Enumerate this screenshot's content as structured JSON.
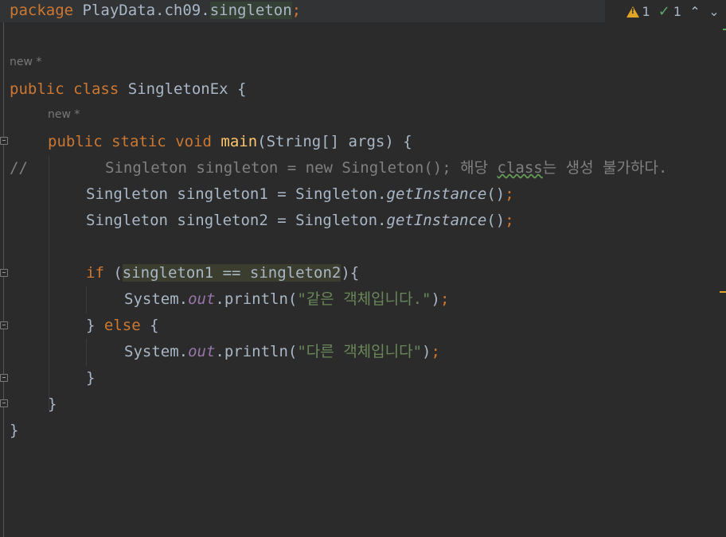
{
  "editor": {
    "line1": {
      "kw": "package",
      "pkg_prefix": "PlayData.ch09.",
      "pkg_hl": "singleton",
      "semi": ";"
    },
    "hint_class": "new *",
    "line3": {
      "kw1": "public",
      "kw2": "class",
      "name": "SingletonEx",
      "brace": "{"
    },
    "hint_method": "new *",
    "line5": {
      "kw1": "public",
      "kw2": "static",
      "kw3": "void",
      "fn": "main",
      "params": "(String[] args) {"
    },
    "line6": {
      "slashes": "//",
      "code": "Singleton singleton = new Singleton(); 해당 ",
      "squig": "class",
      "rest": "는 생성 불가하다."
    },
    "line7": {
      "a": "Singleton singleton1 = Singleton.",
      "call": "getInstance",
      "b": "()",
      "semi": ";"
    },
    "line8": {
      "a": "Singleton singleton2 = Singleton.",
      "call": "getInstance",
      "b": "()",
      "semi": ";"
    },
    "line10": {
      "kw": "if",
      "open": " (",
      "cond": "singleton1 == singleton2",
      "close": "){"
    },
    "line11": {
      "a": "System.",
      "field": "out",
      "b": ".println(",
      "str": "\"같은 객체입니다.\"",
      "c": ")",
      "semi": ";"
    },
    "line12": {
      "a": "} ",
      "kw": "else",
      "b": " {"
    },
    "line13": {
      "a": "System.",
      "field": "out",
      "b": ".println(",
      "str": "\"다른 객체입니다\"",
      "c": ")",
      "semi": ";"
    },
    "line14": "}",
    "line15": "}",
    "line16": "}"
  },
  "toolbar": {
    "warnings_count": "1",
    "weak_warnings_count": "1",
    "warning_icon": "warning-triangle-icon",
    "check_icon": "check-icon",
    "up_icon": "chevron-up-icon",
    "down_icon": "chevron-down-icon"
  },
  "colors": {
    "background": "#2b2b2b",
    "keyword": "#cc7832",
    "function": "#ffc66d",
    "string": "#6a8759",
    "field": "#9876aa",
    "text": "#a9b7c6",
    "comment": "#808080",
    "warning": "#e0a526"
  }
}
